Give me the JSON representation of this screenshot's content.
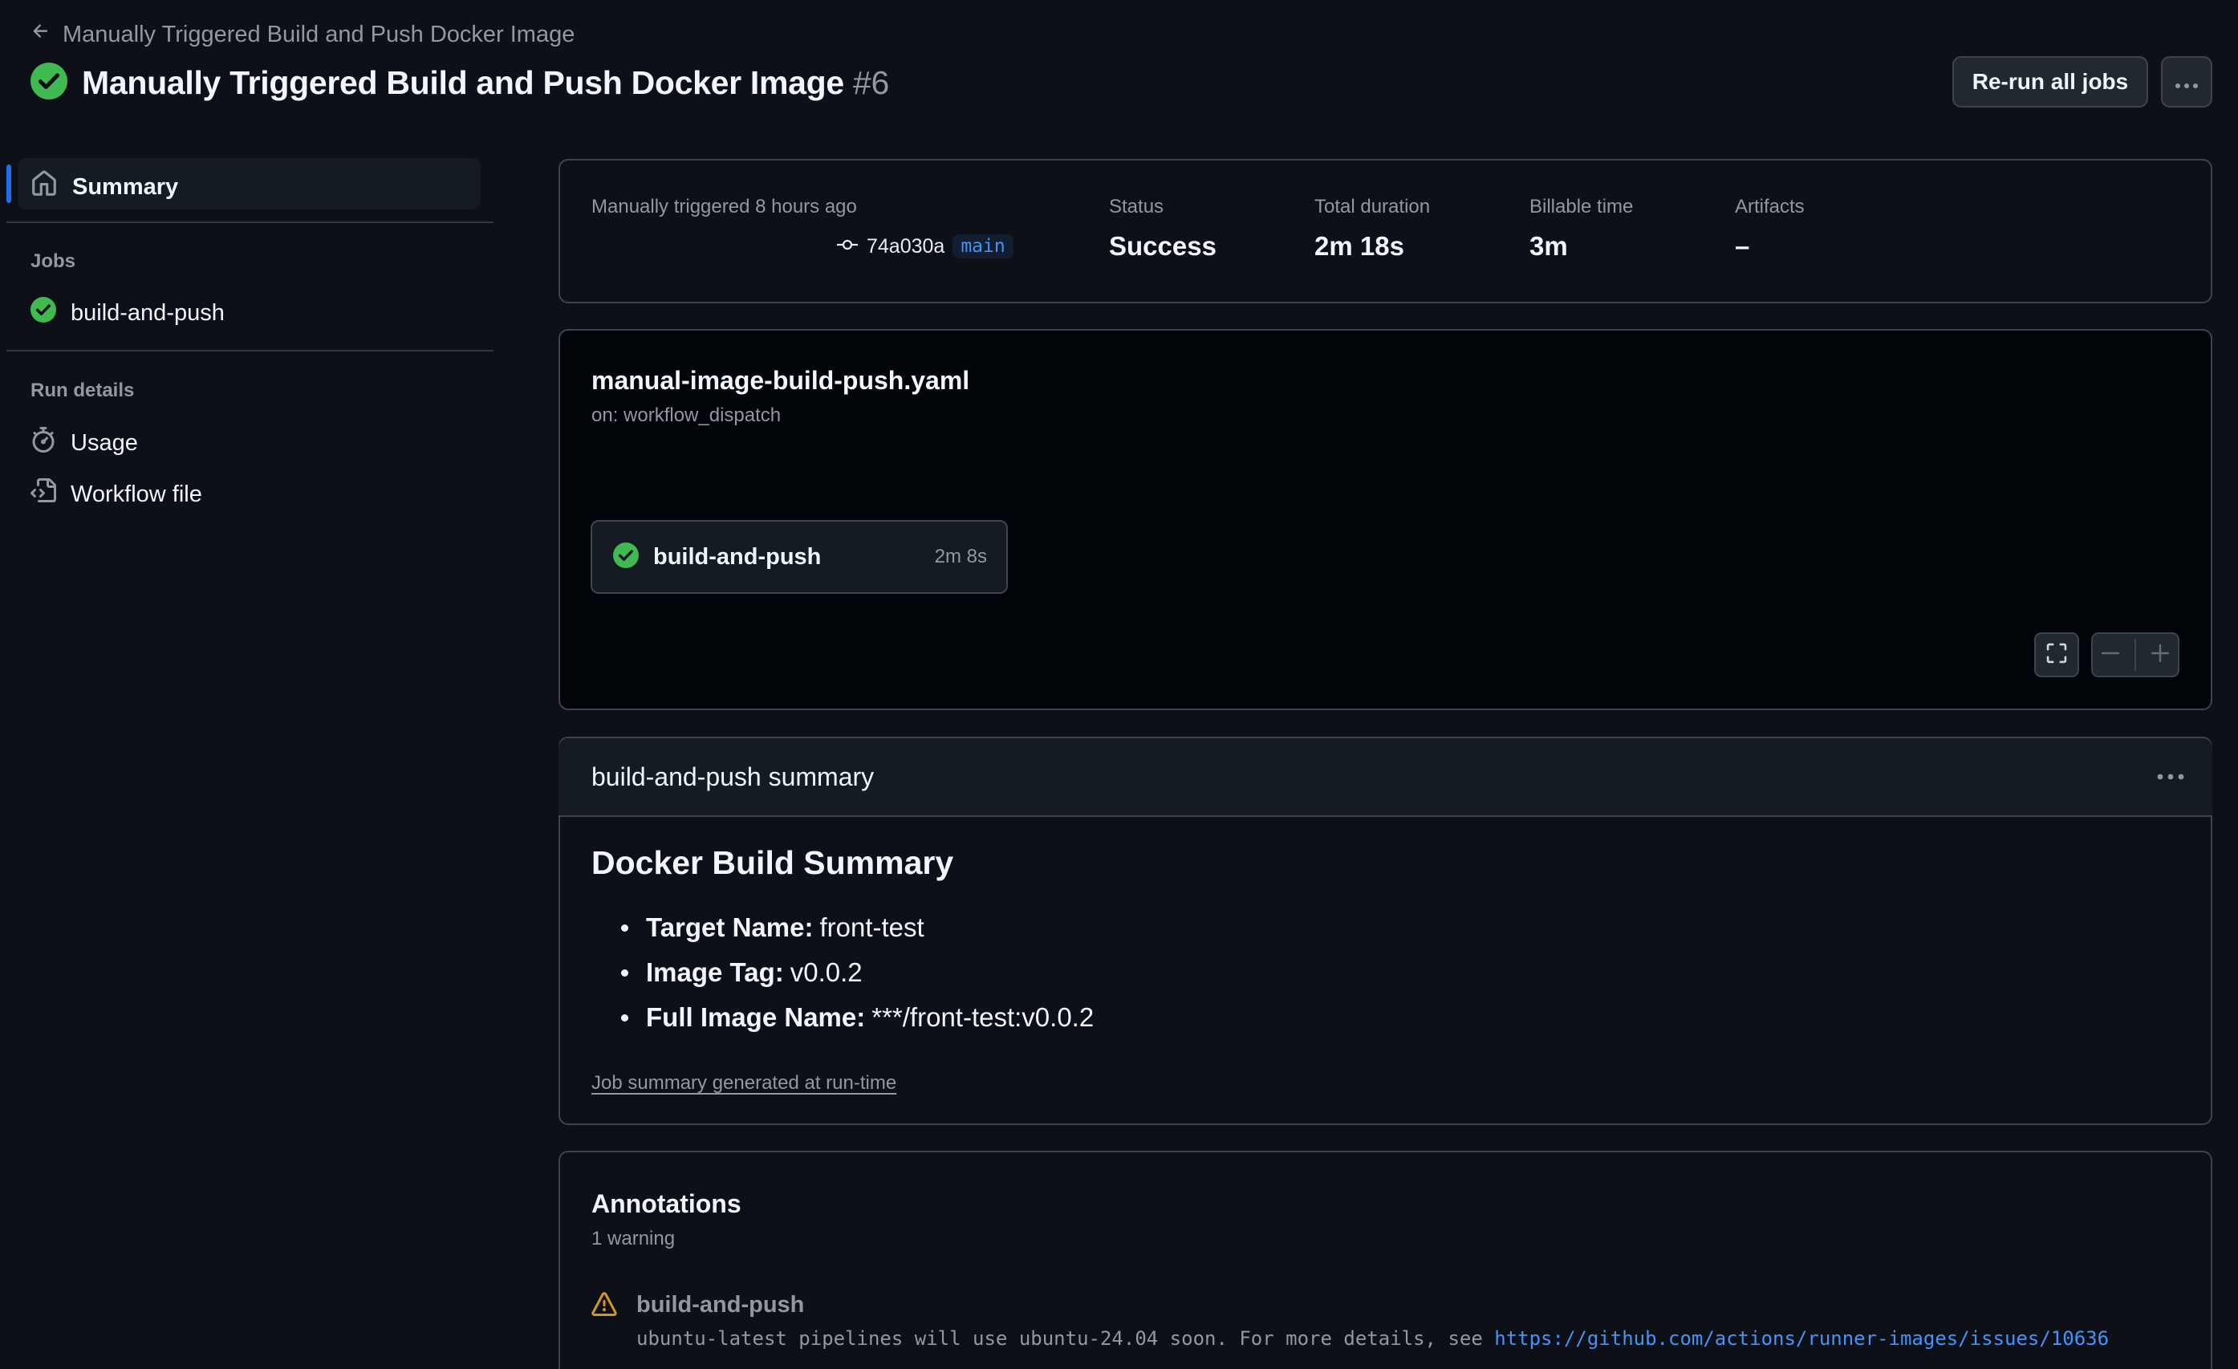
{
  "header": {
    "back_label": "Manually Triggered Build and Push Docker Image",
    "title": "Manually Triggered Build and Push Docker Image",
    "run_number": "#6",
    "rerun_label": "Re-run all jobs"
  },
  "sidebar": {
    "summary_label": "Summary",
    "jobs_heading": "Jobs",
    "job_label": "build-and-push",
    "run_details_heading": "Run details",
    "usage_label": "Usage",
    "workflow_file_label": "Workflow file"
  },
  "run_meta": {
    "trigger_text": "Manually triggered 8 hours ago",
    "commit": "74a030a",
    "branch": "main",
    "status_label": "Status",
    "status_value": "Success",
    "duration_label": "Total duration",
    "duration_value": "2m 18s",
    "billable_label": "Billable time",
    "billable_value": "3m",
    "artifacts_label": "Artifacts",
    "artifacts_value": "–"
  },
  "workflow": {
    "file_name": "manual-image-build-push.yaml",
    "trigger": "on: workflow_dispatch",
    "job_name": "build-and-push",
    "job_duration": "2m 8s"
  },
  "job_summary": {
    "header": "build-and-push summary",
    "heading": "Docker Build Summary",
    "items": [
      {
        "key": "Target Name:",
        "value": "front-test"
      },
      {
        "key": "Image Tag:",
        "value": "v0.0.2"
      },
      {
        "key": "Full Image Name:",
        "value": "***/front-test:v0.0.2"
      }
    ],
    "footer_link": "Job summary generated at run-time"
  },
  "annotations": {
    "title": "Annotations",
    "count": "1 warning",
    "job": "build-and-push",
    "message": "ubuntu-latest pipelines will use ubuntu-24.04 soon. For more details, see ",
    "link": "https://github.com/actions/runner-images/issues/10636"
  },
  "colors": {
    "success": "#3fb950",
    "warning": "#d29922",
    "accent": "#1f6feb",
    "link": "#4493f8"
  }
}
